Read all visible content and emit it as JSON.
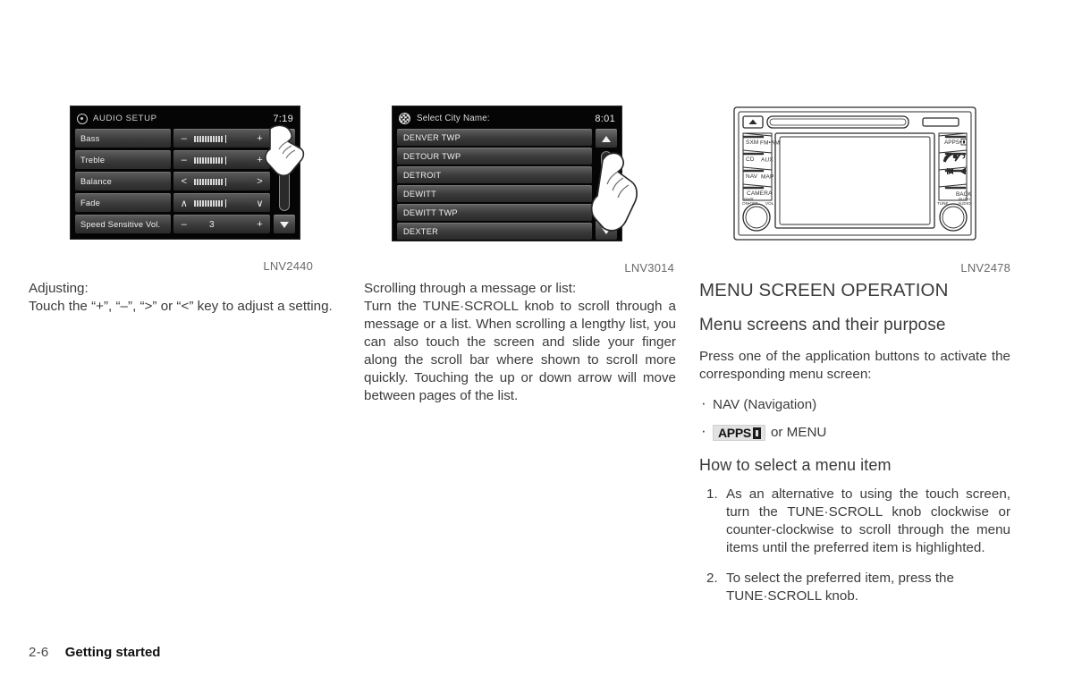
{
  "figures": {
    "audio_setup": {
      "caption": "LNV2440",
      "header": {
        "title": "AUDIO SETUP",
        "clock": "7:19",
        "icon": "gear-icon"
      },
      "rows": [
        {
          "label": "Bass",
          "left": "–",
          "right": "+",
          "control": "meter"
        },
        {
          "label": "Treble",
          "left": "–",
          "right": "+",
          "control": "meter"
        },
        {
          "label": "Balance",
          "left": "<",
          "right": ">",
          "control": "meter"
        },
        {
          "label": "Fade",
          "left": "∧",
          "right": "∨",
          "control": "meter"
        },
        {
          "label": "Speed Sensitive Vol.",
          "left": "–",
          "right": "+",
          "control": "value",
          "value": "3"
        }
      ],
      "scroll": {
        "up": "up-arrow",
        "down": "down-arrow"
      }
    },
    "city_list": {
      "caption": "LNV3014",
      "header": {
        "title": "Select City Name:",
        "clock": "8:01",
        "icon": "destination-flag-icon"
      },
      "items": [
        "DENVER TWP",
        "DETOUR TWP",
        "DETROIT",
        "DEWITT",
        "DEWITT TWP",
        "DEXTER"
      ],
      "scroll": {
        "up": "up-arrow",
        "down": "down-arrow"
      }
    },
    "head_unit": {
      "caption": "LNV2478",
      "left_buttons": [
        {
          "a": "SXM",
          "b": "FM•AM"
        },
        {
          "a": "CD",
          "b": "AUX"
        },
        {
          "a": "NAV",
          "b": "MAP"
        },
        {
          "a": "CAMERA",
          "b": ""
        }
      ],
      "right_buttons": [
        {
          "label": "APPS•"
        },
        {
          "label": "phone-mute-icon"
        },
        {
          "label": "track-seek-icon"
        },
        {
          "label": "BACK"
        }
      ],
      "knob_left": {
        "top": "PWR",
        "sub": "ON•OFF",
        "right": "VOL"
      },
      "knob_right": {
        "left": "TUNE",
        "top": "PUSH",
        "sub": "AUDIO"
      },
      "eject_icon": "eject-icon"
    }
  },
  "col1": {
    "heading": "Adjusting:",
    "paragraph": "Touch the “+”, “–”, “>” or “<” key to adjust a setting."
  },
  "col2": {
    "heading": "Scrolling through a message or list:",
    "paragraph": "Turn the TUNE·SCROLL knob to scroll through a message or a list. When scrolling a lengthy list, you can also touch the screen and slide your finger along the scroll bar where shown to scroll more quickly. Touching the up or down arrow will move between pages of the list."
  },
  "col3": {
    "title": "MENU SCREEN OPERATION",
    "subtitle": "Menu screens and their purpose",
    "intro": "Press one of the application buttons to activate the corresponding menu screen:",
    "bullets": [
      {
        "text": "NAV (Navigation)",
        "badge": null
      },
      {
        "text": "or MENU",
        "badge": "APPS"
      }
    ],
    "howto_title": "How to select a menu item",
    "steps": [
      {
        "num": "1.",
        "text": "As an alternative to using the touch screen, turn the TUNE·SCROLL knob clockwise or counter-clockwise to scroll through the menu items until the preferred item is highlighted."
      },
      {
        "num": "2.",
        "text": "To select the preferred item, press the TUNE·SCROLL knob."
      }
    ]
  },
  "footer": {
    "page": "2-6",
    "section": "Getting started"
  },
  "colors": {
    "text": "#3b3b3b",
    "caption": "#6a6a6a",
    "screen_bg": "#050505",
    "row_light": "#5f5f5f",
    "row_dark": "#2a2a2a"
  }
}
